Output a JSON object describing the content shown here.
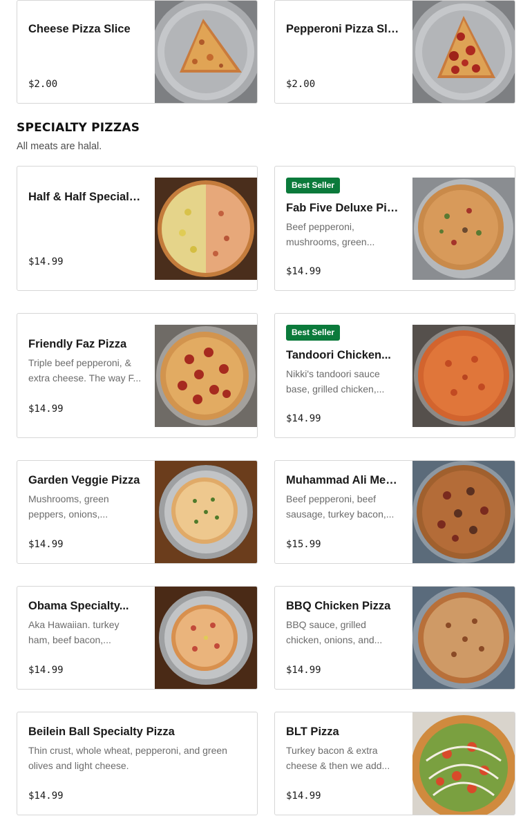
{
  "slices": [
    {
      "name": "Cheese Pizza Slice",
      "price": "$2.00"
    },
    {
      "name": "Pepperoni Pizza Slice",
      "price": "$2.00"
    }
  ],
  "section": {
    "title": "SPECIALTY PIZZAS",
    "subtitle": "All meats are halal."
  },
  "items": [
    {
      "name": "Half & Half Specialty...",
      "price": "$14.99"
    },
    {
      "badge": "Best Seller",
      "name": "Fab Five Deluxe Pizza",
      "desc": "Beef pepperoni, mushrooms, green...",
      "price": "$14.99"
    },
    {
      "name": "Friendly Faz Pizza",
      "desc": "Triple beef pepperoni, & extra cheese. The way F...",
      "price": "$14.99"
    },
    {
      "badge": "Best Seller",
      "name": "Tandoori Chicken...",
      "desc": "Nikki's tandoori sauce base, grilled chicken,...",
      "price": "$14.99"
    },
    {
      "name": "Garden Veggie Pizza",
      "desc": "Mushrooms, green peppers, onions,...",
      "price": "$14.99"
    },
    {
      "name": "Muhammad Ali Meat...",
      "desc": "Beef pepperoni, beef sausage, turkey bacon,...",
      "price": "$15.99"
    },
    {
      "name": "Obama Specialty...",
      "desc": "Aka Hawaiian. turkey ham, beef bacon,...",
      "price": "$14.99"
    },
    {
      "name": "BBQ Chicken Pizza",
      "desc": "BBQ sauce, grilled chicken, onions, and...",
      "price": "$14.99"
    },
    {
      "name": "Beilein Ball Specialty Pizza",
      "desc": "Thin crust, whole wheat, pepperoni, and green olives and light cheese.",
      "price": "$14.99"
    },
    {
      "name": "BLT Pizza",
      "desc": "Turkey bacon & extra cheese & then we add...",
      "price": "$14.99"
    }
  ],
  "colors": {
    "badge_bg": "#0b7a3b",
    "price_text": "#191919",
    "desc_text": "#6b6b6b"
  }
}
